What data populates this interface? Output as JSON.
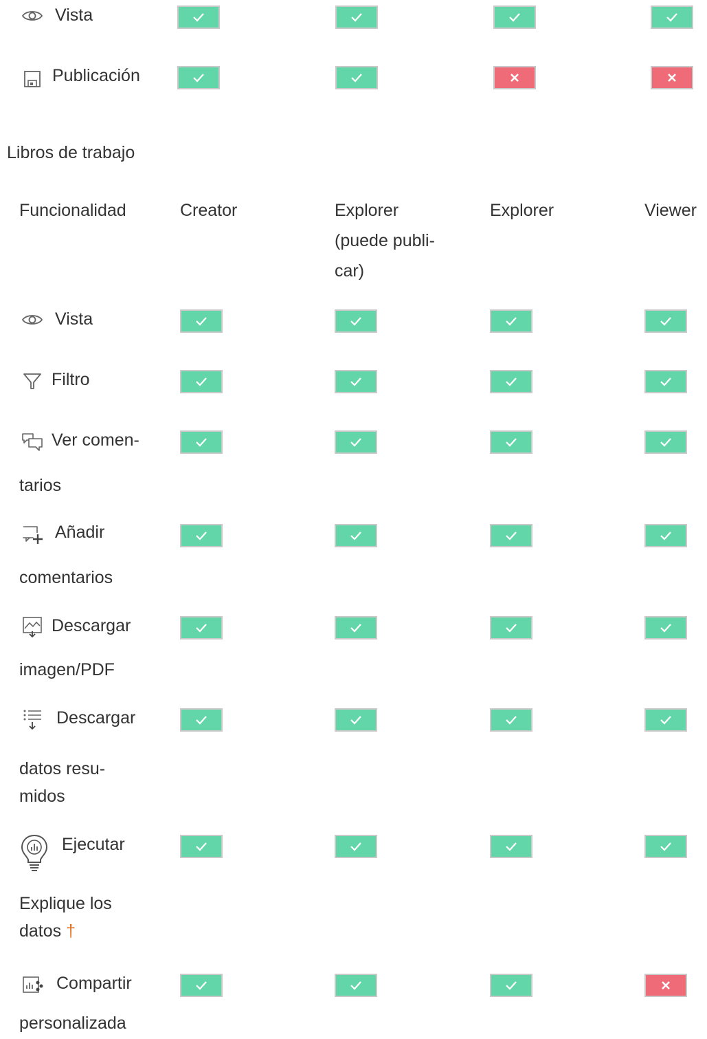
{
  "colors": {
    "allowed": "#62d6a8",
    "denied": "#f06b78",
    "text": "#333333",
    "dagger": "#e07025"
  },
  "top_table": {
    "rows": [
      {
        "icon": "eye-icon",
        "label": "Vista",
        "values": [
          "allowed",
          "allowed",
          "allowed",
          "allowed"
        ]
      },
      {
        "icon": "save-icon",
        "label": "Publicación",
        "values": [
          "allowed",
          "allowed",
          "denied",
          "denied"
        ]
      }
    ]
  },
  "section": {
    "title": "Libros de trabajo"
  },
  "workbooks_table": {
    "headers": {
      "feature": "Funcionalidad",
      "col1": "Creator",
      "col2_l1": "Explorer",
      "col2_l2": "(puede publi-",
      "col2_l3": "car)",
      "col3": "Explorer",
      "col4": "Viewer"
    },
    "rows": [
      {
        "icon": "eye-icon",
        "label_l1": "Vista",
        "values": [
          "allowed",
          "allowed",
          "allowed",
          "allowed"
        ]
      },
      {
        "icon": "filter-icon",
        "label_l1": "Filtro",
        "values": [
          "allowed",
          "allowed",
          "allowed",
          "allowed"
        ]
      },
      {
        "icon": "comments-icon",
        "label_l1": "Ver comen-",
        "label_l2": "tarios",
        "values": [
          "allowed",
          "allowed",
          "allowed",
          "allowed"
        ]
      },
      {
        "icon": "add-comment-icon",
        "label_l1": "Añadir",
        "label_l2": "comentarios",
        "values": [
          "allowed",
          "allowed",
          "allowed",
          "allowed"
        ]
      },
      {
        "icon": "download-image-icon",
        "label_l1": "Descargar",
        "label_l2": "imagen/PDF",
        "values": [
          "allowed",
          "allowed",
          "allowed",
          "allowed"
        ]
      },
      {
        "icon": "download-data-icon",
        "label_l1": "Descargar",
        "label_l2": "datos resu-",
        "label_l3": "midos",
        "values": [
          "allowed",
          "allowed",
          "allowed",
          "allowed"
        ]
      },
      {
        "icon": "lightbulb-icon",
        "label_l1": "Ejecutar",
        "label_l2": "Explique los",
        "label_l3": "datos",
        "label_mark": "†",
        "values": [
          "allowed",
          "allowed",
          "allowed",
          "allowed"
        ]
      },
      {
        "icon": "share-custom-view-icon",
        "label_l1": "Compartir",
        "label_l2": "personalizada",
        "values": [
          "allowed",
          "allowed",
          "allowed",
          "denied"
        ]
      }
    ]
  }
}
